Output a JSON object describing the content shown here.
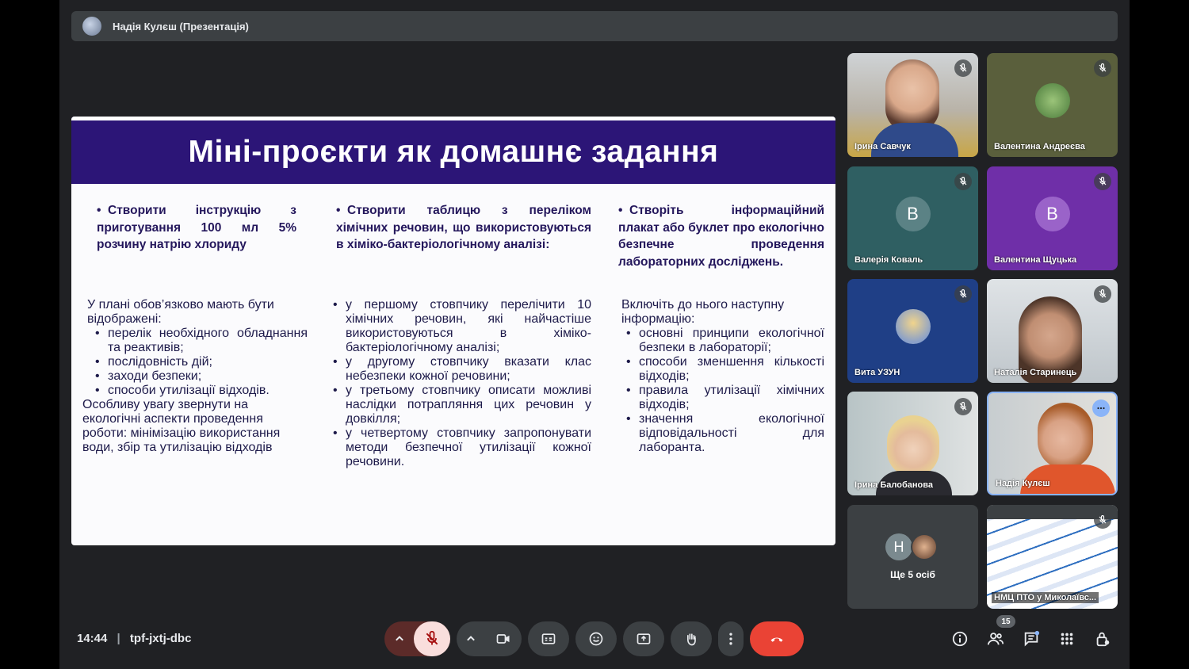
{
  "presenter": {
    "name": "Надія Кулєш (Презентація)"
  },
  "slide": {
    "title": "Міні-проєкти як домашнє задання",
    "col1": {
      "heading": "Створити інструкцію з приготування 100 мл 5% розчину натрію хлориду",
      "intro": "У плані обов’язково мають бути відображені:",
      "items": [
        "перелік необхідного обладнання та реактивів;",
        "послідовність дій;",
        "заходи безпеки;",
        "способи утилізації відходів."
      ],
      "outro": "Особливу увагу звернути на екологічні аспекти проведення роботи: мінімізацію використання води, збір та утилізацію відходів"
    },
    "col2": {
      "heading": "Створити таблицю з переліком хімічних речовин, що використовуються в хіміко-бактеріологічному аналізі:",
      "items": [
        "у першому стовпчику перелічити 10 хімічних речовин, які найчастіше використовуються в хіміко-бактеріологічному аналізі;",
        "у другому стовпчику вказати клас небезпеки кожної речовини;",
        "у третьому стовпчику описати можливі наслідки потрапляння цих речовин у довкілля;",
        "у четвертому стовпчику запропонувати методи безпечної утилізації кожної речовини."
      ]
    },
    "col3": {
      "heading": "Створіть інформаційний плакат або буклет про екологічно безпечне проведення лабораторних досліджень.",
      "intro": "Включіть до нього наступну інформацію:",
      "items": [
        "основні принципи екологічної безпеки в лабораторії;",
        "способи зменшення кількості відходів;",
        "правила утилізації хімічних відходів;",
        "значення екологічної відповідальності для лаборанта."
      ]
    }
  },
  "participants": [
    {
      "name": "Ірина Савчук",
      "kind": "video"
    },
    {
      "name": "Валентина Андреєва",
      "kind": "photo"
    },
    {
      "name": "Валерія Коваль",
      "initial": "В",
      "kind": "initial"
    },
    {
      "name": "Валентина Щуцька",
      "initial": "В",
      "kind": "initial"
    },
    {
      "name": "Вита УЗУН",
      "kind": "photo"
    },
    {
      "name": "Наталія Старинець",
      "kind": "video"
    },
    {
      "name": "Ірина Балобанова",
      "kind": "video"
    },
    {
      "name": "Надія Кулєш",
      "kind": "video"
    },
    {
      "name": "Ще 5 осіб",
      "initial": "Н",
      "kind": "more"
    },
    {
      "name": "НМЦ ПТО у Миколаївс...",
      "kind": "video"
    }
  ],
  "meeting": {
    "time": "14:44",
    "separator": "|",
    "code": "tpf-jxtj-dbc"
  },
  "people_count": "15",
  "colors": {
    "slide_header": "#2c1577",
    "end_call": "#ea4335",
    "mic_off": "#f9dedc",
    "accent_blue": "#8ab4f8"
  }
}
